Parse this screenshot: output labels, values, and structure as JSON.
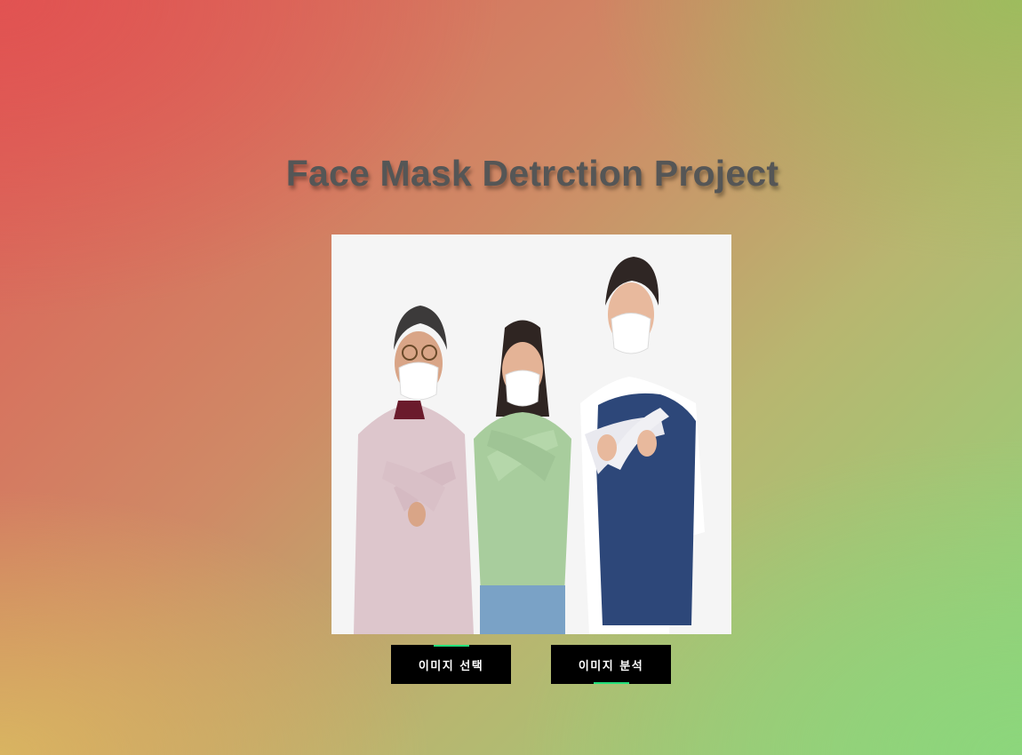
{
  "header": {
    "title": "Face Mask Detrction Project"
  },
  "preview": {
    "image_description_icon": "people-with-masks-photo"
  },
  "buttons": {
    "select_label": "이미지 선택",
    "analyze_label": "이미지 분석"
  },
  "colors": {
    "button_bg": "#000000",
    "button_text": "#ffffff",
    "accent": "#22e07a",
    "title_text": "#555656"
  }
}
